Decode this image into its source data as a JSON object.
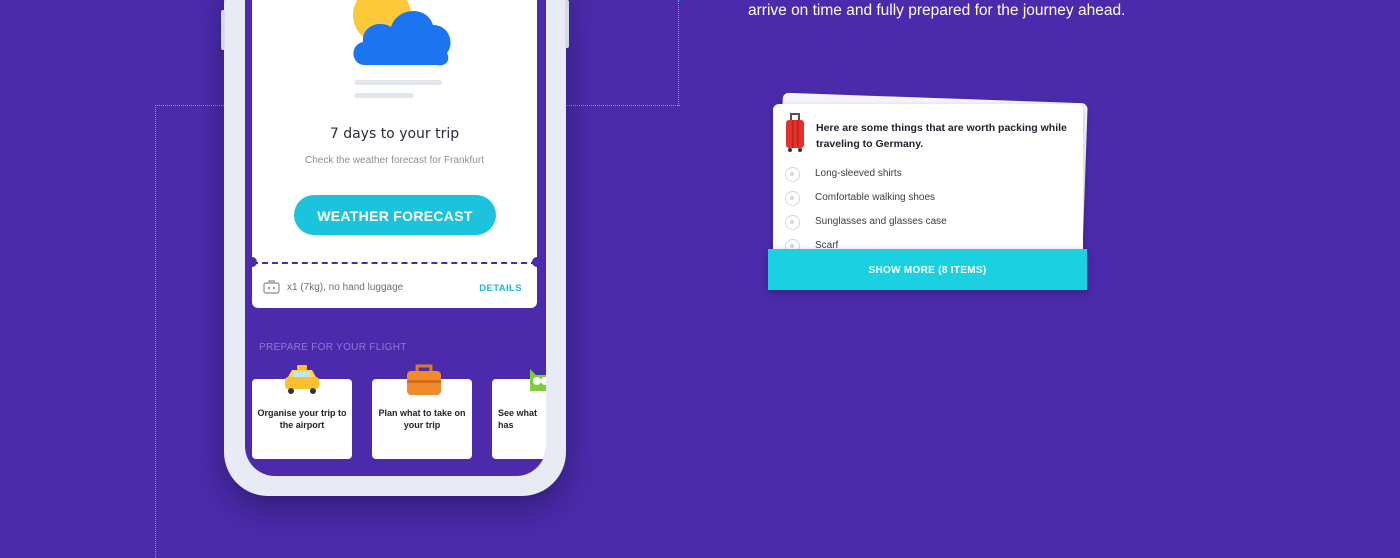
{
  "hero": {
    "text": "arrive on time and fully prepared for the journey ahead."
  },
  "phone": {
    "trip_card": {
      "weather_icon": "sun-behind-cloud-icon",
      "title": "7 days to your trip",
      "subtitle": "Check the weather forecast for Frankfurt",
      "button_label": "WEATHER FORECAST",
      "luggage_icon": "luggage-icon",
      "luggage_text": "x1 (7kg), no hand luggage",
      "details_label": "DETAILS"
    },
    "prepare_section": {
      "heading": "PREPARE FOR YOUR FLIGHT",
      "cards": [
        {
          "label": "Organise your trip to the airport",
          "icon": "taxi-icon"
        },
        {
          "label": "Plan what to take on your trip",
          "icon": "suitcase-icon"
        },
        {
          "label": "See what has",
          "icon": "owl-icon"
        }
      ]
    }
  },
  "packing_card": {
    "icon": "red-suitcase-icon",
    "title": "Here are some things that are worth packing while traveling to Germany.",
    "items": [
      "Long-sleeved shirts",
      "Comfortable walking shoes",
      "Sunglasses and glasses case",
      "Scarf"
    ],
    "show_more_label": "SHOW MORE (8 ITEMS)"
  },
  "colors": {
    "background": "#4b2bab",
    "accent": "#1bc4dc",
    "dotted_lines": "#3fb6e6"
  }
}
